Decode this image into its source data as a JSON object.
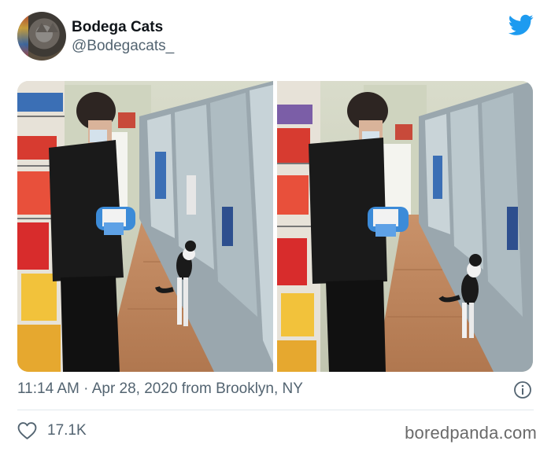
{
  "tweet": {
    "display_name": "Bodega Cats",
    "handle": "@Bodegacats_",
    "timestamp": "11:14 AM · Apr 28, 2020 from Brooklyn, NY",
    "like_count": "17.1K"
  },
  "icons": {
    "logo": "twitter-bird-icon",
    "info": "info-icon",
    "like": "heart-icon"
  },
  "watermark": "boredpanda.com",
  "colors": {
    "twitter_blue": "#1d9bf0",
    "text_primary": "#0f1419",
    "text_secondary": "#536471",
    "divider": "#e1e8ed"
  }
}
